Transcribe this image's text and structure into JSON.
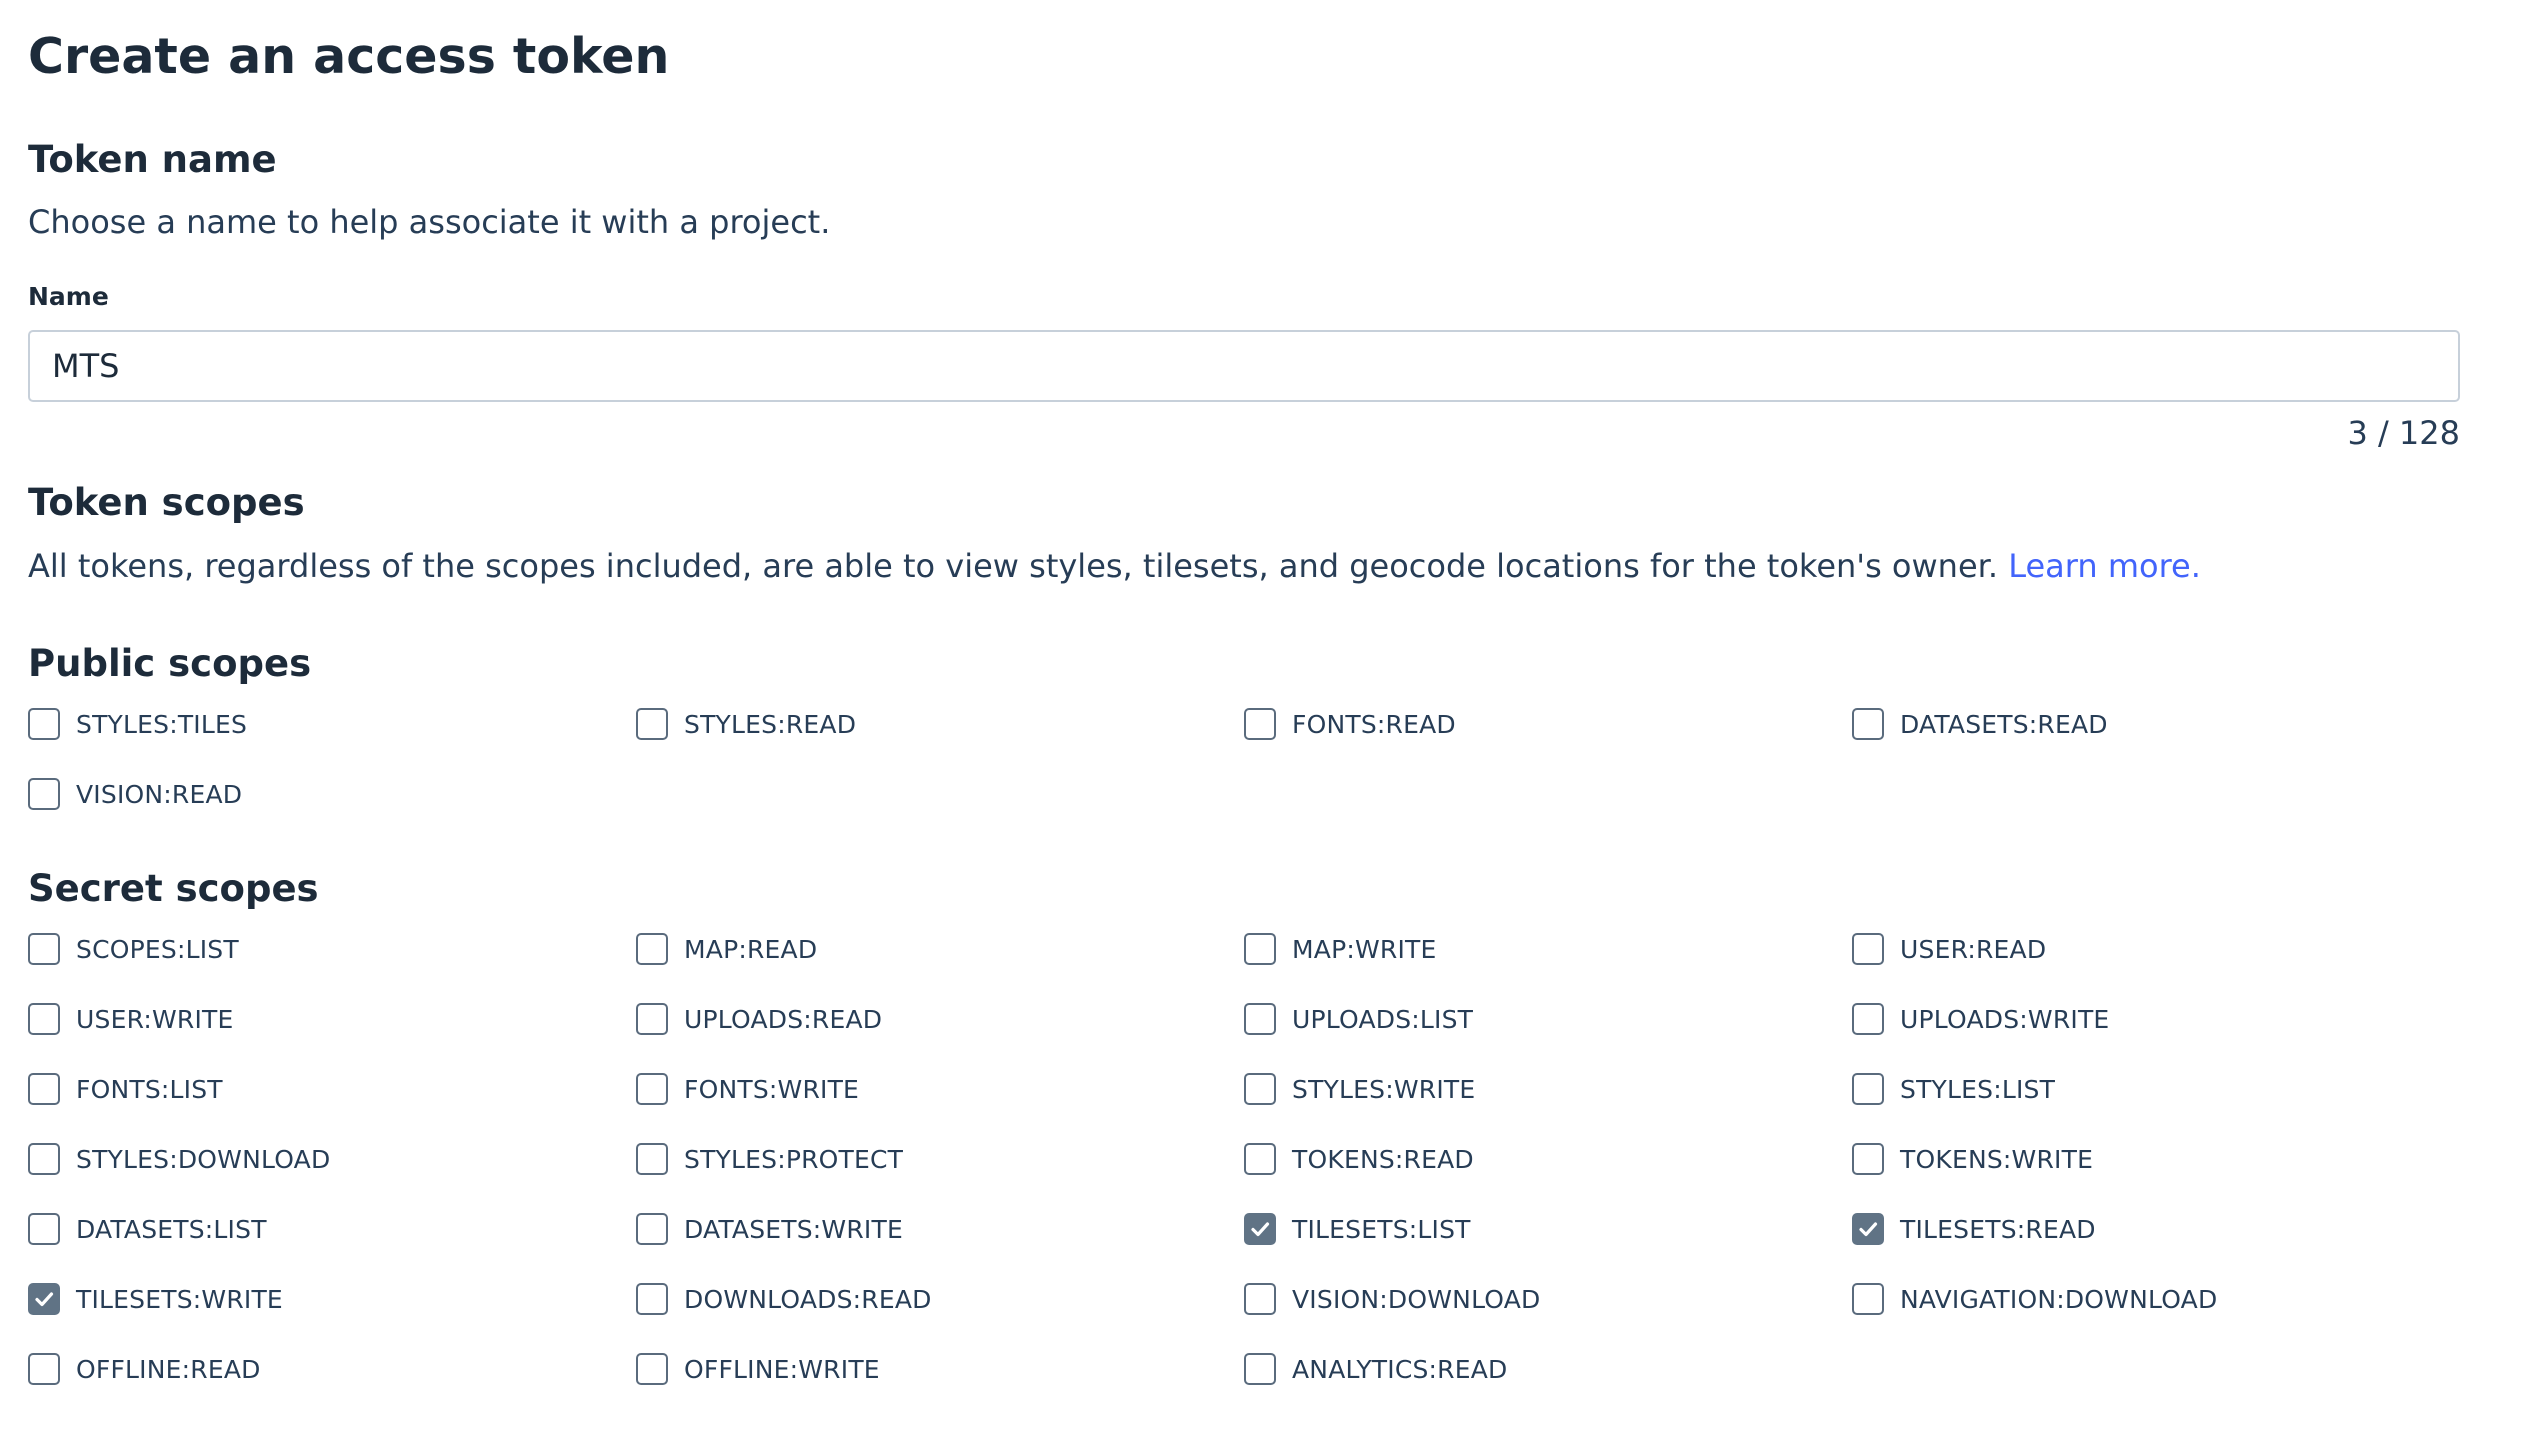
{
  "page_title": "Create an access token",
  "token_name": {
    "heading": "Token name",
    "description": "Choose a name to help associate it with a project.",
    "field_label": "Name",
    "value": "MTS",
    "counter": "3 / 128"
  },
  "token_scopes": {
    "heading": "Token scopes",
    "description": "All tokens, regardless of the scopes included, are able to view styles, tilesets, and geocode locations for the token's owner.",
    "learn_more": "Learn more."
  },
  "public_scopes": {
    "heading": "Public scopes",
    "items": [
      {
        "label": "STYLES:TILES",
        "checked": false
      },
      {
        "label": "STYLES:READ",
        "checked": false
      },
      {
        "label": "FONTS:READ",
        "checked": false
      },
      {
        "label": "DATASETS:READ",
        "checked": false
      },
      {
        "label": "VISION:READ",
        "checked": false
      }
    ]
  },
  "secret_scopes": {
    "heading": "Secret scopes",
    "items": [
      {
        "label": "SCOPES:LIST",
        "checked": false
      },
      {
        "label": "MAP:READ",
        "checked": false
      },
      {
        "label": "MAP:WRITE",
        "checked": false
      },
      {
        "label": "USER:READ",
        "checked": false
      },
      {
        "label": "USER:WRITE",
        "checked": false
      },
      {
        "label": "UPLOADS:READ",
        "checked": false
      },
      {
        "label": "UPLOADS:LIST",
        "checked": false
      },
      {
        "label": "UPLOADS:WRITE",
        "checked": false
      },
      {
        "label": "FONTS:LIST",
        "checked": false
      },
      {
        "label": "FONTS:WRITE",
        "checked": false
      },
      {
        "label": "STYLES:WRITE",
        "checked": false
      },
      {
        "label": "STYLES:LIST",
        "checked": false
      },
      {
        "label": "STYLES:DOWNLOAD",
        "checked": false
      },
      {
        "label": "STYLES:PROTECT",
        "checked": false
      },
      {
        "label": "TOKENS:READ",
        "checked": false
      },
      {
        "label": "TOKENS:WRITE",
        "checked": false
      },
      {
        "label": "DATASETS:LIST",
        "checked": false
      },
      {
        "label": "DATASETS:WRITE",
        "checked": false
      },
      {
        "label": "TILESETS:LIST",
        "checked": true
      },
      {
        "label": "TILESETS:READ",
        "checked": true
      },
      {
        "label": "TILESETS:WRITE",
        "checked": true
      },
      {
        "label": "DOWNLOADS:READ",
        "checked": false
      },
      {
        "label": "VISION:DOWNLOAD",
        "checked": false
      },
      {
        "label": "NAVIGATION:DOWNLOAD",
        "checked": false
      },
      {
        "label": "OFFLINE:READ",
        "checked": false
      },
      {
        "label": "OFFLINE:WRITE",
        "checked": false
      },
      {
        "label": "ANALYTICS:READ",
        "checked": false
      }
    ]
  },
  "icons": {
    "checkbox_checked": "check-icon"
  },
  "colors": {
    "link": "#4264fb",
    "checkbox_checked_fill": "#607385",
    "input_border": "#c7d0da"
  }
}
